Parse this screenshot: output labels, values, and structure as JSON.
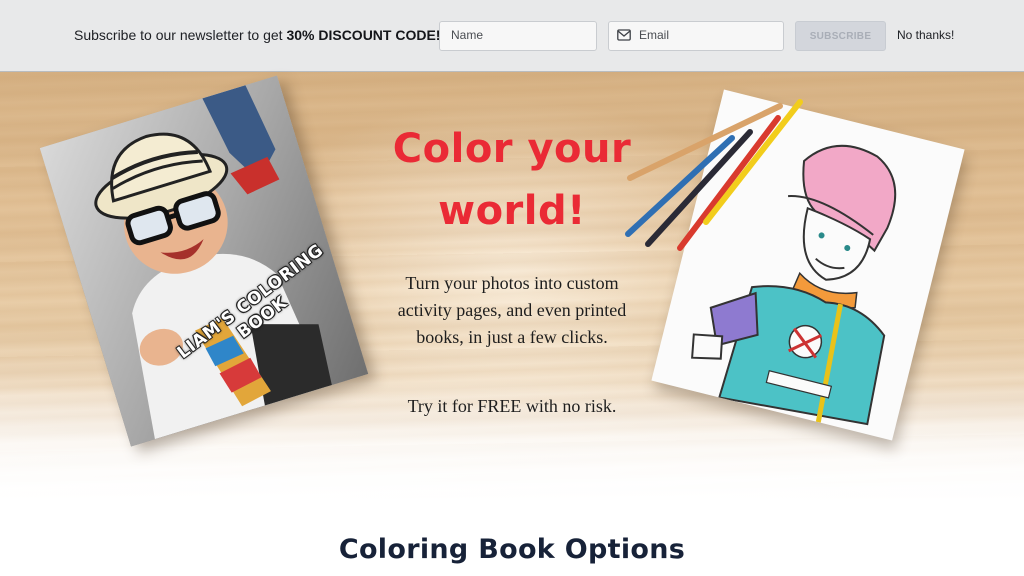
{
  "newsletter": {
    "text_prefix": "Subscribe to our newsletter to get ",
    "text_bold": "30% DISCOUNT CODE!",
    "name_placeholder": "Name",
    "email_placeholder": "Email",
    "subscribe_label": "SUBSCRIBE",
    "dismiss_label": "No thanks!",
    "email_icon": "mail-icon"
  },
  "hero": {
    "title_line1": "Color your",
    "title_line2": "world!",
    "body_line1": "Turn your photos into custom",
    "body_line2": "activity pages, and even printed",
    "body_line3": "books, in just a few clicks.",
    "cta": "Try it for FREE with no risk.",
    "book_title_line1": "LIAM'S COLORING",
    "book_title_line2": "BOOK"
  },
  "section": {
    "title": "Coloring Book Options"
  },
  "colors": {
    "accent_red": "#ea2a35",
    "heading_navy": "#172238",
    "bar_background": "#e8e9ea"
  }
}
